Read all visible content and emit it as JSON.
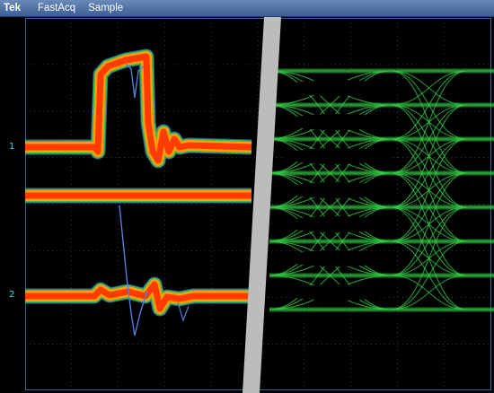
{
  "menubar": {
    "brand": "Tek",
    "items": [
      "FastAcq",
      "Sample"
    ]
  },
  "display": {
    "channels": [
      {
        "marker": "1",
        "color": "#3cd6e0"
      },
      {
        "marker": "2",
        "color": "#3cd6e0"
      }
    ],
    "colors": {
      "background": "#000000",
      "graticule": "#3b5f8e",
      "trace_hot": "#ff3c00",
      "trace_warm": "#ffa000",
      "trace_cool": "#33bb55",
      "trace_outline": "#4f7fd8",
      "eye_pattern": "#33cc44",
      "divider": "#bcbcbc"
    }
  }
}
